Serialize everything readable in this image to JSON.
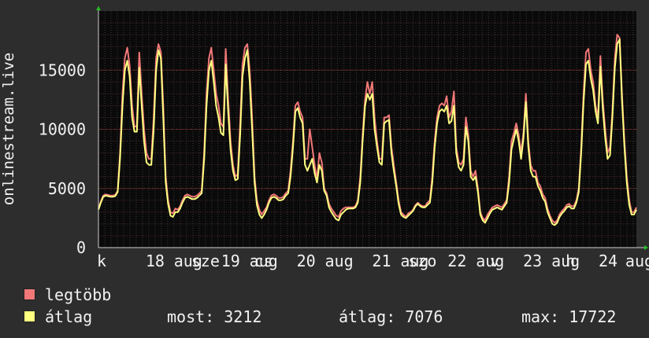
{
  "chart_data": {
    "type": "line",
    "ylabel": "onlinestream.live",
    "ylim": [
      0,
      20000
    ],
    "yticks": [
      0,
      5000,
      10000,
      15000
    ],
    "grid": true,
    "xlim": [
      0,
      171
    ],
    "xticks": [
      {
        "x": 1,
        "label": "k"
      },
      {
        "x": 18,
        "label": "18"
      },
      {
        "x": 28.5,
        "label": "aug"
      },
      {
        "x": 34,
        "label": "sze"
      },
      {
        "x": 42,
        "label": "19"
      },
      {
        "x": 52.5,
        "label": "aug"
      },
      {
        "x": 52.5,
        "label": "cs"
      },
      {
        "x": 66,
        "label": "20"
      },
      {
        "x": 76.5,
        "label": "aug"
      },
      {
        "x": 90,
        "label": "21"
      },
      {
        "x": 100.5,
        "label": "aug"
      },
      {
        "x": 103,
        "label": "szo"
      },
      {
        "x": 114,
        "label": "22"
      },
      {
        "x": 124.5,
        "label": "aug"
      },
      {
        "x": 126,
        "label": "v"
      },
      {
        "x": 138,
        "label": "23"
      },
      {
        "x": 148.5,
        "label": "aug"
      },
      {
        "x": 150,
        "label": "h"
      },
      {
        "x": 162,
        "label": "24"
      },
      {
        "x": 172,
        "label": "aug"
      }
    ],
    "series": [
      {
        "name": "legtöbb",
        "color": "#f27878",
        "values": [
          3300,
          3900,
          4400,
          4500,
          4450,
          4400,
          4400,
          4450,
          4800,
          8000,
          13000,
          16000,
          16900,
          15400,
          12000,
          10200,
          10300,
          16500,
          13000,
          10000,
          8000,
          7500,
          7500,
          11000,
          16000,
          17200,
          16500,
          12000,
          6000,
          4000,
          3000,
          2900,
          3300,
          3200,
          3500,
          4000,
          4400,
          4500,
          4400,
          4300,
          4300,
          4400,
          4600,
          4800,
          8000,
          13000,
          16000,
          16900,
          15000,
          13000,
          12000,
          10500,
          10200,
          16800,
          12500,
          9000,
          7000,
          6000,
          6200,
          10500,
          15500,
          16900,
          17200,
          15000,
          11000,
          6000,
          4000,
          3200,
          2800,
          3100,
          3400,
          4000,
          4400,
          4500,
          4400,
          4200,
          4200,
          4300,
          4600,
          4800,
          6500,
          9000,
          12000,
          12300,
          11500,
          11000,
          7500,
          7500,
          10000,
          8500,
          7000,
          5800,
          8000,
          7200,
          5000,
          4600,
          3700,
          3300,
          3000,
          2700,
          2600,
          3100,
          3300,
          3400,
          3400,
          3400,
          3400,
          3500,
          4000,
          6000,
          9500,
          12500,
          14000,
          13000,
          14000,
          11000,
          9000,
          7500,
          7500,
          11000,
          11000,
          11200,
          8500,
          7000,
          5500,
          4000,
          3000,
          2800,
          2600,
          2900,
          3000,
          3200,
          3600,
          3800,
          3600,
          3500,
          3500,
          3800,
          4000,
          6000,
          9000,
          11000,
          12000,
          12200,
          12000,
          12800,
          11000,
          11500,
          13200,
          8500,
          7200,
          7000,
          7500,
          11000,
          9500,
          6500,
          6000,
          6500,
          5000,
          3000,
          2500,
          2300,
          2800,
          3100,
          3400,
          3500,
          3600,
          3500,
          3400,
          3700,
          4000,
          6000,
          9000,
          9700,
          10500,
          9500,
          8000,
          9800,
          13000,
          9000,
          7000,
          6500,
          6500,
          5500,
          5200,
          4500,
          4200,
          3300,
          2700,
          2300,
          2100,
          2300,
          2800,
          3100,
          3300,
          3600,
          3700,
          3500,
          3500,
          4000,
          5000,
          8500,
          13000,
          16500,
          16800,
          15000,
          14000,
          12000,
          11000,
          16200,
          12500,
          10000,
          8000,
          8500,
          11500,
          16000,
          18000,
          17700,
          13000,
          9000,
          6000,
          4000,
          3000,
          3000,
          3400
        ]
      },
      {
        "name": "átlag",
        "color": "#ffff80",
        "values": [
          3200,
          3800,
          4300,
          4400,
          4350,
          4300,
          4300,
          4350,
          4700,
          7500,
          12000,
          15000,
          15800,
          14500,
          11000,
          9800,
          9800,
          15200,
          12000,
          9000,
          7200,
          7000,
          7000,
          10000,
          15000,
          16700,
          16000,
          11000,
          5500,
          3700,
          2700,
          2600,
          3000,
          3000,
          3300,
          3800,
          4200,
          4300,
          4200,
          4100,
          4100,
          4200,
          4400,
          4600,
          7500,
          12000,
          15000,
          15800,
          14000,
          12000,
          11000,
          9700,
          9500,
          15500,
          11500,
          8300,
          6500,
          5700,
          5800,
          9500,
          14500,
          16000,
          16700,
          14000,
          10000,
          5500,
          3600,
          2800,
          2500,
          2800,
          3200,
          3800,
          4200,
          4300,
          4200,
          4000,
          4000,
          4100,
          4400,
          4600,
          6000,
          8500,
          11500,
          11800,
          11000,
          10500,
          7000,
          6500,
          7000,
          7500,
          6300,
          5500,
          7000,
          6500,
          4800,
          4400,
          3400,
          3000,
          2700,
          2400,
          2300,
          2800,
          3000,
          3200,
          3300,
          3300,
          3300,
          3400,
          3800,
          5500,
          9000,
          12000,
          13000,
          12500,
          13000,
          10000,
          8500,
          7200,
          7000,
          10500,
          10700,
          10800,
          8000,
          6500,
          5200,
          3700,
          2800,
          2600,
          2500,
          2700,
          2900,
          3100,
          3500,
          3700,
          3500,
          3400,
          3400,
          3600,
          3800,
          5500,
          8500,
          10500,
          11500,
          11700,
          11500,
          12000,
          10500,
          10700,
          12000,
          8000,
          6800,
          6500,
          7000,
          10200,
          9000,
          6000,
          5700,
          6000,
          4700,
          2800,
          2300,
          2100,
          2500,
          2900,
          3200,
          3300,
          3400,
          3300,
          3200,
          3500,
          3800,
          5500,
          8300,
          9200,
          10000,
          9000,
          7500,
          9300,
          12300,
          8500,
          6500,
          6000,
          6000,
          5200,
          4800,
          4200,
          3900,
          3000,
          2500,
          2000,
          1900,
          2100,
          2600,
          2900,
          3100,
          3400,
          3500,
          3300,
          3300,
          3800,
          4700,
          8000,
          12300,
          15500,
          15800,
          14300,
          13300,
          11500,
          10500,
          15300,
          11800,
          9300,
          7500,
          7800,
          11000,
          15200,
          17200,
          17600,
          12500,
          8500,
          5500,
          3600,
          2800,
          2800,
          3212
        ]
      }
    ]
  },
  "legend": [
    {
      "label": "legtöbb",
      "color": "#f27878"
    },
    {
      "label": "átlag",
      "color": "#ffff80"
    }
  ],
  "stats": {
    "most": "most: 3212",
    "atlag": "átlag: 7076",
    "max": "max: 17722"
  }
}
